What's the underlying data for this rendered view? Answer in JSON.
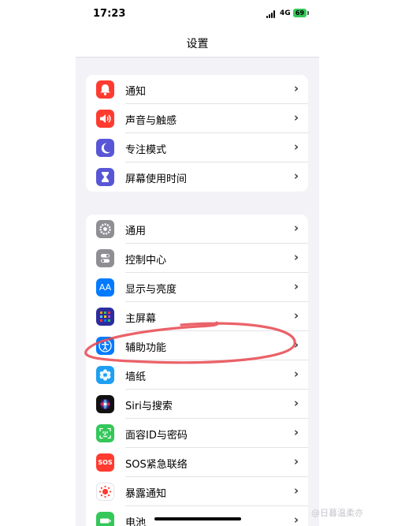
{
  "status_bar": {
    "time": "17:23",
    "network": "4G",
    "battery": "69"
  },
  "header": {
    "title": "设置"
  },
  "groups": [
    {
      "items": [
        {
          "label": "通知",
          "icon": "bell-icon",
          "color": "#ff3b30"
        },
        {
          "label": "声音与触感",
          "icon": "speaker-icon",
          "color": "#ff3b30"
        },
        {
          "label": "专注模式",
          "icon": "moon-icon",
          "color": "#5856d6"
        },
        {
          "label": "屏幕使用时间",
          "icon": "hourglass-icon",
          "color": "#5856d6"
        }
      ]
    },
    {
      "items": [
        {
          "label": "通用",
          "icon": "gear-icon",
          "color": "#8e8e93"
        },
        {
          "label": "控制中心",
          "icon": "toggle-switches-icon",
          "color": "#8e8e93"
        },
        {
          "label": "显示与亮度",
          "icon": "text-size-icon",
          "color": "#007aff"
        },
        {
          "label": "主屏幕",
          "icon": "app-grid-icon",
          "color": "#2c2c9e"
        },
        {
          "label": "辅助功能",
          "icon": "accessibility-icon",
          "color": "#007aff"
        },
        {
          "label": "墙纸",
          "icon": "flower-icon",
          "color": "#1e9ff2"
        },
        {
          "label": "Siri与搜索",
          "icon": "siri-icon",
          "color": "#111111"
        },
        {
          "label": "面容ID与密码",
          "icon": "face-id-icon",
          "color": "#34c759"
        },
        {
          "label": "SOS紧急联络",
          "icon": "sos-icon",
          "color": "#ff3b30"
        },
        {
          "label": "暴露通知",
          "icon": "exposure-icon",
          "color": "#ffffff"
        },
        {
          "label": "电池",
          "icon": "battery-icon",
          "color": "#34c759"
        }
      ]
    }
  ],
  "icon_text": {
    "text_size": "AA",
    "sos": "SOS"
  },
  "annotation_color": "#e8474d",
  "watermark": "@日暮温柔亦"
}
